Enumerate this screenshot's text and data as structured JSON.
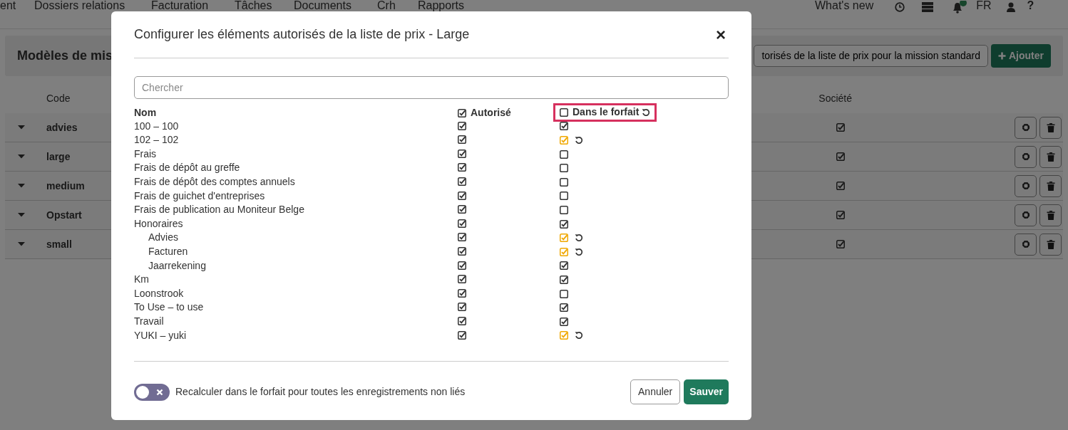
{
  "navbar": {
    "menu": [
      "ent",
      "Dossiers relations",
      "Facturation",
      "Tâches",
      "Documents",
      "Crh",
      "Rapports"
    ],
    "whats_new": "What's new",
    "language": "FR",
    "help": "?"
  },
  "page": {
    "title": "Modèles de mis",
    "config_button": "torisés de la liste de prix pour la mission standard",
    "add_button": "Ajouter",
    "table": {
      "columns": [
        "Code",
        "Société"
      ],
      "rows": [
        {
          "code": "advies",
          "company": true
        },
        {
          "code": "large",
          "company": true
        },
        {
          "code": "medium",
          "company": true
        },
        {
          "code": "Opstart",
          "company": true
        },
        {
          "code": "small",
          "company": true
        }
      ]
    }
  },
  "modal": {
    "title": "Configurer les éléments autorisés de la liste de prix - Large",
    "close": "×",
    "search": {
      "placeholder": "Chercher"
    },
    "columns": {
      "name": "Nom",
      "authorized": {
        "label": "Autorisé",
        "checked": true
      },
      "in_package": {
        "label": "Dans le forfait",
        "checked": false,
        "highlighted": true
      }
    },
    "items": [
      {
        "name": "100 – 100",
        "authorized": true,
        "in_package": true,
        "overridden": false
      },
      {
        "name": "102 – 102",
        "authorized": true,
        "in_package": true,
        "overridden": true
      },
      {
        "name": "Frais",
        "authorized": true,
        "in_package": false,
        "overridden": false
      },
      {
        "name": "Frais de dépôt au greffe",
        "authorized": true,
        "in_package": false,
        "overridden": false
      },
      {
        "name": "Frais de dépôt des comptes annuels",
        "authorized": true,
        "in_package": false,
        "overridden": false
      },
      {
        "name": "Frais de guichet d'entreprises",
        "authorized": true,
        "in_package": false,
        "overridden": false
      },
      {
        "name": "Frais de publication au Moniteur Belge",
        "authorized": true,
        "in_package": false,
        "overridden": false
      },
      {
        "name": "Honoraires",
        "authorized": true,
        "in_package": true,
        "overridden": false,
        "children": [
          {
            "name": "Advies",
            "authorized": true,
            "in_package": true,
            "overridden": true
          },
          {
            "name": "Facturen",
            "authorized": true,
            "in_package": true,
            "overridden": true
          },
          {
            "name": "Jaarrekening",
            "authorized": true,
            "in_package": true,
            "overridden": false
          }
        ]
      },
      {
        "name": "Km",
        "authorized": true,
        "in_package": true,
        "overridden": false
      },
      {
        "name": "Loonstrook",
        "authorized": true,
        "in_package": false,
        "overridden": false
      },
      {
        "name": "To Use – to use",
        "authorized": true,
        "in_package": true,
        "overridden": false
      },
      {
        "name": "Travail",
        "authorized": true,
        "in_package": true,
        "overridden": false
      },
      {
        "name": "YUKI – yuki",
        "authorized": true,
        "in_package": true,
        "overridden": true
      }
    ],
    "footer": {
      "toggle": {
        "label": "Recalculer dans le forfait pour toutes les enregistrements non liés",
        "on": false
      },
      "cancel": "Annuler",
      "save": "Sauver"
    }
  }
}
